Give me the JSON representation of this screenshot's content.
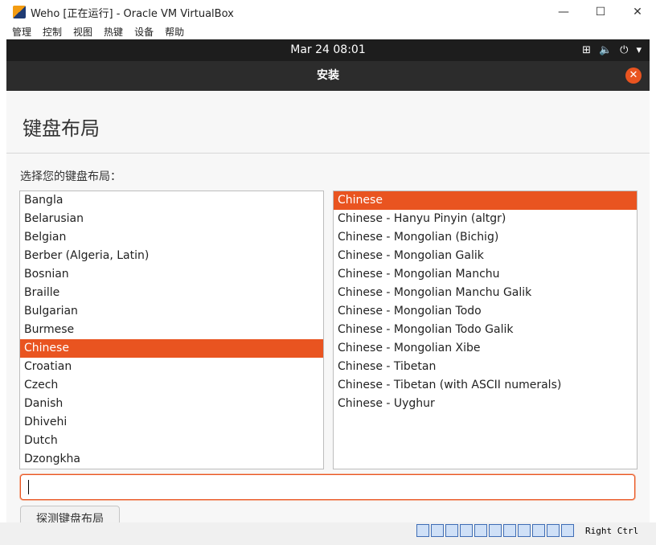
{
  "window": {
    "title": "Weho [正在运行] - Oracle VM VirtualBox",
    "controls": {
      "minimize": "—",
      "maximize": "☐",
      "close": "✕"
    }
  },
  "menubar": {
    "items": [
      "管理",
      "控制",
      "视图",
      "热键",
      "设备",
      "帮助"
    ]
  },
  "guest": {
    "clock": "Mar 24  08:01",
    "tray": {
      "network": "⊞",
      "volume": "🔈",
      "power": "⏻",
      "menu": "▾"
    },
    "installer": {
      "title": "安装",
      "close_label": "✕",
      "page_title": "键盘布局",
      "prompt": "选择您的键盘布局：",
      "layouts": [
        "Bangla",
        "Belarusian",
        "Belgian",
        "Berber (Algeria, Latin)",
        "Bosnian",
        "Braille",
        "Bulgarian",
        "Burmese",
        "Chinese",
        "Croatian",
        "Czech",
        "Danish",
        "Dhivehi",
        "Dutch",
        "Dzongkha"
      ],
      "selected_layout": "Chinese",
      "variants": [
        "Chinese",
        "Chinese - Hanyu Pinyin (altgr)",
        "Chinese - Mongolian (Bichig)",
        "Chinese - Mongolian Galik",
        "Chinese - Mongolian Manchu",
        "Chinese - Mongolian Manchu Galik",
        "Chinese - Mongolian Todo",
        "Chinese - Mongolian Todo Galik",
        "Chinese - Mongolian Xibe",
        "Chinese - Tibetan",
        "Chinese - Tibetan (with ASCII numerals)",
        "Chinese - Uyghur"
      ],
      "selected_variant": "Chinese",
      "test_input_value": "",
      "detect_button": "探测键盘布局"
    }
  },
  "statusbar": {
    "host_key": "Right Ctrl"
  },
  "colors": {
    "accent": "#e95420",
    "topbar": "#1d1d1d",
    "header": "#2c2c2c"
  }
}
